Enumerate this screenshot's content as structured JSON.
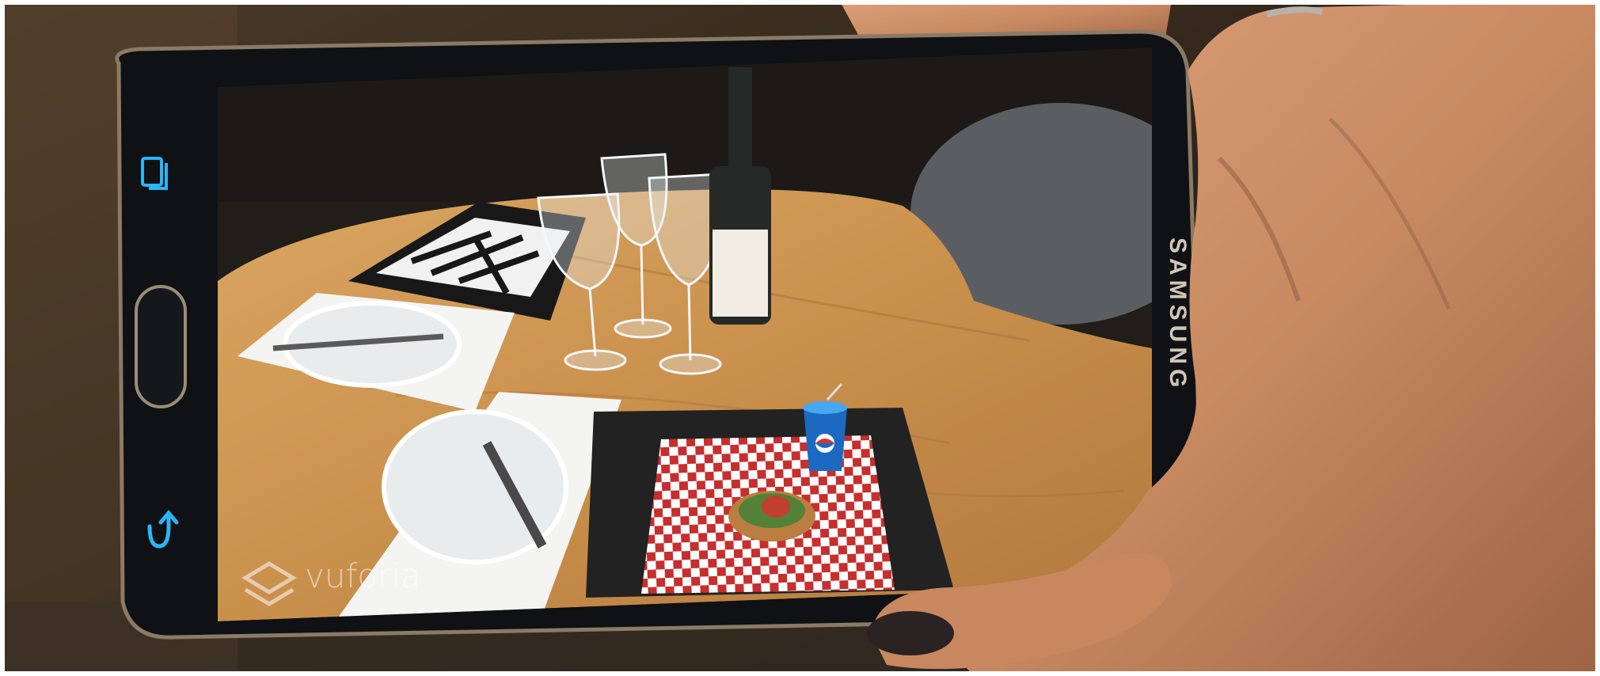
{
  "photo": {
    "device_brand": "SAMSUNG",
    "ar_watermark": "vuforia",
    "colors": {
      "background": "#2a2118",
      "phone_frame": "#16191d",
      "nav_button": "#29b6f6",
      "table_wood": "#c8904c",
      "tablecloth_red": "#c62828",
      "skin": "#c98a62"
    }
  },
  "phone_ui": {
    "nav_buttons": [
      {
        "name": "recent-apps",
        "icon": "recent-apps-icon"
      },
      {
        "name": "home",
        "icon": "home-button"
      },
      {
        "name": "back",
        "icon": "back-arrow-icon"
      }
    ]
  }
}
